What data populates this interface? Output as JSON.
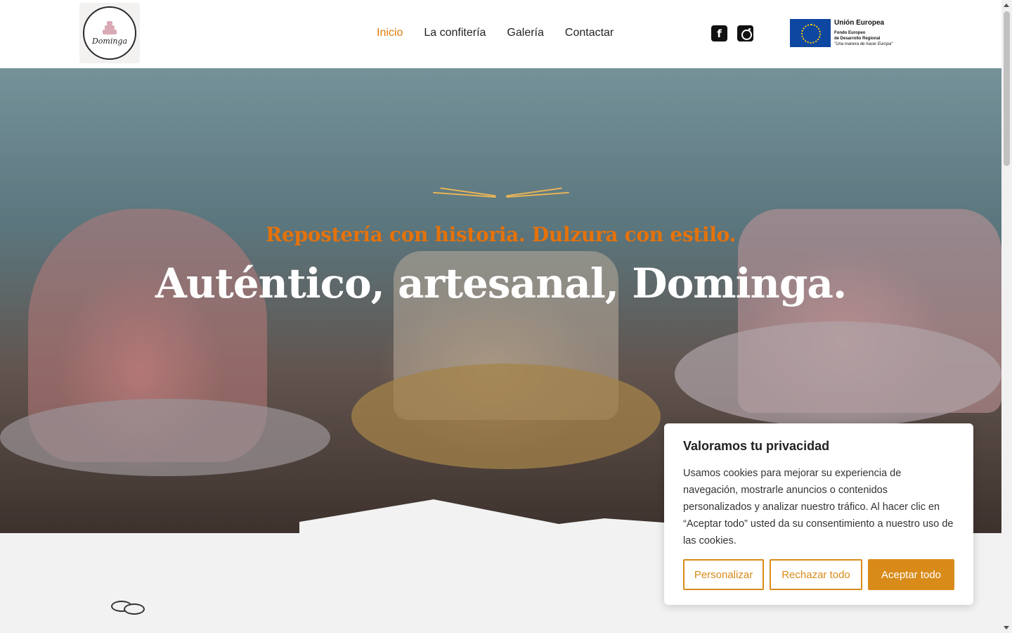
{
  "header": {
    "logo_text": "Dominga",
    "nav": [
      {
        "label": "Inicio",
        "active": true
      },
      {
        "label": "La confitería",
        "active": false
      },
      {
        "label": "Galería",
        "active": false
      },
      {
        "label": "Contactar",
        "active": false
      }
    ],
    "social": [
      {
        "name": "facebook-icon",
        "glyph": "f"
      },
      {
        "name": "instagram-icon",
        "glyph": ""
      }
    ],
    "eu": {
      "title": "Unión Europea",
      "line1": "Fondo Europeo",
      "line2": "de Desarrollo Regional",
      "motto": "\"Una manera de hacer Europa\""
    }
  },
  "hero": {
    "tagline": "Repostería con historia. Dulzura con estilo.",
    "headline": "Auténtico, artesanal, Dominga."
  },
  "cookie_banner": {
    "title": "Valoramos tu privacidad",
    "text": "Usamos cookies para mejorar su experiencia de navegación, mostrarle anuncios o contenidos personalizados y analizar nuestro tráfico. Al hacer clic en “Aceptar todo” usted da su consentimiento a nuestro uso de las cookies.",
    "buttons": {
      "customize": "Personalizar",
      "reject": "Rechazar todo",
      "accept": "Aceptar todo"
    }
  },
  "colors": {
    "accent": "#e07b0b",
    "button": "#d98b1a",
    "background": "#f2f2f2"
  }
}
